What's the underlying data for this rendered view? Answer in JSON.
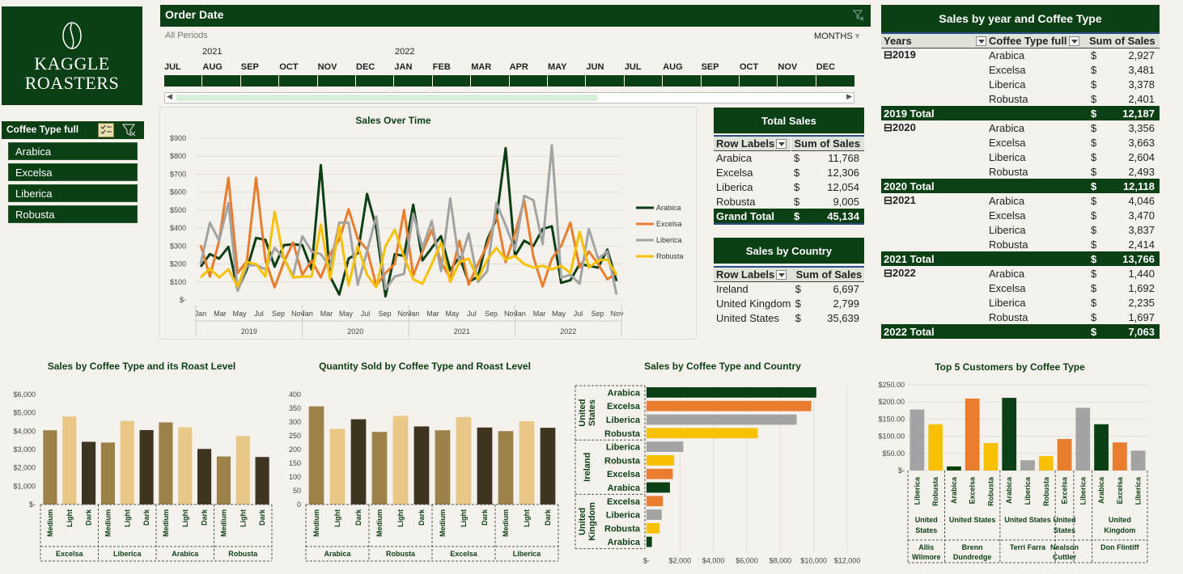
{
  "logo": {
    "line1": "KAGGLE",
    "line2": "ROASTERS"
  },
  "slicer": {
    "title": "Coffee Type full",
    "items": [
      "Arabica",
      "Excelsa",
      "Liberica",
      "Robusta"
    ]
  },
  "timeline": {
    "title": "Order Date",
    "periods_label": "All Periods",
    "level_label": "MONTHS",
    "years": [
      "2021",
      "2022"
    ],
    "months": [
      "JUL",
      "AUG",
      "SEP",
      "OCT",
      "NOV",
      "DEC",
      "JAN",
      "FEB",
      "MAR",
      "APR",
      "MAY",
      "JUN",
      "JUL",
      "AUG",
      "SEP",
      "OCT",
      "NOV",
      "DEC"
    ]
  },
  "colors": {
    "arabica": "#0b3f14",
    "excelsa": "#e97d2e",
    "liberica": "#a3a3a3",
    "robusta": "#f8c100",
    "light": "#e9c787",
    "medium": "#9c8148",
    "dark": "#3e3420"
  },
  "total_sales": {
    "title": "Total Sales",
    "col1": "Row Labels",
    "col2": "Sum of Sales",
    "rows": [
      {
        "label": "Arabica",
        "cur": "$",
        "value": "11,768"
      },
      {
        "label": "Excelsa",
        "cur": "$",
        "value": "12,306"
      },
      {
        "label": "Liberica",
        "cur": "$",
        "value": "12,054"
      },
      {
        "label": "Robusta",
        "cur": "$",
        "value": "9,005"
      }
    ],
    "grand": {
      "label": "Grand Total",
      "cur": "$",
      "value": "45,134"
    }
  },
  "sales_by_country": {
    "title": "Sales by Country",
    "col1": "Row Labels",
    "col2": "Sum of Sales",
    "rows": [
      {
        "label": "Ireland",
        "cur": "$",
        "value": "6,697"
      },
      {
        "label": "United Kingdom",
        "cur": "$",
        "value": "2,799"
      },
      {
        "label": "United States",
        "cur": "$",
        "value": "35,639"
      }
    ]
  },
  "sales_by_year": {
    "title": "Sales by year and Coffee Type",
    "cols": [
      "Years",
      "Coffee Type full",
      "Sum of Sales"
    ],
    "groups": [
      {
        "year": "2019",
        "rows": [
          [
            "Arabica",
            "2,927"
          ],
          [
            "Excelsa",
            "3,481"
          ],
          [
            "Liberica",
            "3,378"
          ],
          [
            "Robusta",
            "2,401"
          ]
        ],
        "total_label": "2019 Total",
        "total": "12,187"
      },
      {
        "year": "2020",
        "rows": [
          [
            "Arabica",
            "3,356"
          ],
          [
            "Excelsa",
            "3,663"
          ],
          [
            "Liberica",
            "2,604"
          ],
          [
            "Robusta",
            "2,493"
          ]
        ],
        "total_label": "2020 Total",
        "total": "12,118"
      },
      {
        "year": "2021",
        "rows": [
          [
            "Arabica",
            "4,046"
          ],
          [
            "Excelsa",
            "3,470"
          ],
          [
            "Liberica",
            "3,837"
          ],
          [
            "Robusta",
            "2,414"
          ]
        ],
        "total_label": "2021 Total",
        "total": "13,766"
      },
      {
        "year": "2022",
        "rows": [
          [
            "Arabica",
            "1,440"
          ],
          [
            "Excelsa",
            "1,692"
          ],
          [
            "Liberica",
            "2,235"
          ],
          [
            "Robusta",
            "1,697"
          ]
        ],
        "total_label": "2022 Total",
        "total": "7,063"
      }
    ],
    "cur": "$"
  },
  "chart_data": [
    {
      "type": "line",
      "title": "Sales Over Time",
      "ylim": [
        0,
        900
      ],
      "yticks": [
        "$-",
        "$100",
        "$200",
        "$300",
        "$400",
        "$500",
        "$600",
        "$700",
        "$800",
        "$900"
      ],
      "month_labels": [
        "Jan",
        "Mar",
        "May",
        "Jul",
        "Sep",
        "Nov"
      ],
      "years": [
        "2019",
        "2020",
        "2021",
        "2022"
      ],
      "series": [
        {
          "name": "Arabica",
          "color": "#0b3f14",
          "values": [
            185,
            255,
            230,
            295,
            55,
            170,
            345,
            335,
            185,
            305,
            310,
            305,
            170,
            750,
            130,
            30,
            230,
            260,
            590,
            400,
            20,
            255,
            245,
            530,
            220,
            290,
            355,
            165,
            240,
            100,
            130,
            335,
            450,
            845,
            245,
            330,
            300,
            395,
            410,
            95,
            110,
            200,
            190,
            180,
            280,
            105
          ]
        },
        {
          "name": "Excelsa",
          "color": "#e97d2e",
          "values": [
            305,
            130,
            330,
            680,
            150,
            215,
            680,
            220,
            70,
            210,
            320,
            140,
            220,
            125,
            255,
            335,
            505,
            340,
            280,
            80,
            150,
            200,
            500,
            135,
            270,
            390,
            210,
            120,
            330,
            85,
            200,
            305,
            475,
            210,
            370,
            555,
            240,
            75,
            230,
            300,
            430,
            180,
            270,
            200,
            115,
            150
          ]
        },
        {
          "name": "Liberica",
          "color": "#a3a3a3",
          "values": [
            200,
            430,
            330,
            540,
            50,
            190,
            195,
            170,
            290,
            230,
            135,
            355,
            270,
            255,
            185,
            430,
            430,
            85,
            270,
            465,
            60,
            130,
            145,
            480,
            290,
            440,
            160,
            565,
            200,
            370,
            100,
            160,
            540,
            415,
            280,
            580,
            555,
            310,
            860,
            125,
            140,
            90,
            395,
            230,
            270,
            30
          ]
        },
        {
          "name": "Robusta",
          "color": "#f8c100",
          "values": [
            125,
            175,
            125,
            170,
            75,
            210,
            200,
            130,
            490,
            230,
            125,
            130,
            130,
            420,
            115,
            410,
            80,
            300,
            140,
            70,
            300,
            390,
            240,
            115,
            90,
            200,
            320,
            100,
            210,
            230,
            115,
            225,
            290,
            225,
            245,
            200,
            180,
            190,
            170,
            190,
            150,
            380,
            180,
            220,
            225,
            140
          ]
        }
      ]
    },
    {
      "type": "bar",
      "title": "Sales by Coffee Type and its Roast Level",
      "ylim": [
        0,
        6000
      ],
      "yticks": [
        "$-",
        "$1,000",
        "$2,000",
        "$3,000",
        "$4,000",
        "$5,000",
        "$6,000"
      ],
      "groups": [
        "Excelsa",
        "Liberica",
        "Arabica",
        "Robusta"
      ],
      "levels": [
        "Medium",
        "Light",
        "Dark"
      ],
      "values": [
        [
          4050,
          4800,
          3420
        ],
        [
          3380,
          4560,
          4060
        ],
        [
          4480,
          4210,
          3030
        ],
        [
          2620,
          3740,
          2590
        ]
      ]
    },
    {
      "type": "bar",
      "title": "Quantity Sold by Coffee Type and Roast Level",
      "ylim": [
        0,
        400
      ],
      "yticks": [
        "0",
        "50",
        "100",
        "150",
        "200",
        "250",
        "300",
        "350",
        "400"
      ],
      "groups": [
        "Arabica",
        "Robusta",
        "Excelsa",
        "Liberica"
      ],
      "levels": [
        "Medium",
        "Light",
        "Dark"
      ],
      "values": [
        [
          357,
          275,
          310
        ],
        [
          264,
          322,
          284
        ],
        [
          270,
          318,
          280
        ],
        [
          267,
          303,
          279
        ]
      ]
    },
    {
      "type": "bar",
      "orientation": "horizontal",
      "title": "Sales by Coffee Type and Country",
      "xlim": [
        0,
        12000
      ],
      "xticks": [
        "$-",
        "$2,000",
        "$4,000",
        "$6,000",
        "$8,000",
        "$10,000",
        "$12,000"
      ],
      "countries": [
        {
          "name": "United States",
          "items": [
            [
              "Arabica",
              10150
            ],
            [
              "Excelsa",
              9850
            ],
            [
              "Liberica",
              8980
            ],
            [
              "Robusta",
              6650
            ]
          ]
        },
        {
          "name": "Ireland",
          "items": [
            [
              "Liberica",
              2200
            ],
            [
              "Robusta",
              1650
            ],
            [
              "Excelsa",
              1570
            ],
            [
              "Arabica",
              1400
            ]
          ]
        },
        {
          "name": "United Kingdom",
          "items": [
            [
              "Excelsa",
              980
            ],
            [
              "Liberica",
              910
            ],
            [
              "Robusta",
              780
            ],
            [
              "Arabica",
              320
            ]
          ]
        }
      ]
    },
    {
      "type": "bar",
      "title": "Top 5 Customers by Coffee Type",
      "ylim": [
        0,
        250
      ],
      "yticks": [
        "$-",
        "$50.00",
        "$100.00",
        "$150.00",
        "$200.00",
        "$250.00"
      ],
      "customers": [
        {
          "country": "United States",
          "name": "Allis Wilmore",
          "items": [
            [
              "Liberica",
              178
            ],
            [
              "Robusta",
              135
            ]
          ]
        },
        {
          "country": "United States",
          "name": "Brenn Dundredge",
          "items": [
            [
              "Arabica",
              12
            ],
            [
              "Excelsa",
              210
            ],
            [
              "Robusta",
              80
            ]
          ]
        },
        {
          "country": "United States",
          "name": "Terri Farra",
          "items": [
            [
              "Arabica",
              212
            ],
            [
              "Liberica",
              30
            ],
            [
              "Robusta",
              42
            ]
          ]
        },
        {
          "country": "United States",
          "name": "Nealson Cuttler",
          "items": [
            [
              "Excelsa",
              92
            ]
          ]
        },
        {
          "country": "Liberica",
          "name": "",
          "items": [
            [
              "Liberica",
              183
            ]
          ]
        },
        {
          "country": "United Kingdom",
          "name": "Don Flintiff",
          "items": [
            [
              "Arabica",
              135
            ],
            [
              "Excelsa",
              82
            ],
            [
              "Liberica",
              58
            ]
          ]
        }
      ]
    }
  ]
}
